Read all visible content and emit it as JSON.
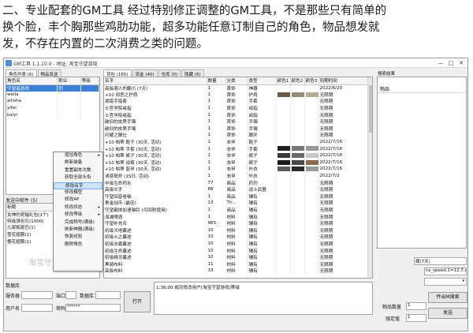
{
  "caption": {
    "line1": "二、专业配套的GM工具   经过特别修正调整的GM工具，不是那些只有简单的",
    "line2": "换个脸，丰个胸那些鸡肋功能，超多功能任意订制自己的角色，物品想发就",
    "line3": "发，不存在内置的二次消费之类的问题。"
  },
  "window": {
    "title": "GM工具 1.1.10.0 - 地址: 淘宝守望游戏",
    "min": "—",
    "max": "□",
    "close": "✕"
  },
  "left": {
    "tabs": [
      "角色列表 (6)",
      "物品发送"
    ],
    "columns": [
      "角色名",
      "职业",
      "等级"
    ],
    "rows": [
      {
        "name": "守望者游戏",
        "job": "剑",
        "level": ""
      },
      {
        "name": "weila",
        "job": "",
        "level": ""
      },
      {
        "name": "ailisha",
        "job": "",
        "level": ""
      },
      {
        "name": "yifei",
        "job": "",
        "level": ""
      },
      {
        "name": "kaiyi",
        "job": "",
        "level": ""
      }
    ],
    "mail_title": "发送中邮件 (5)",
    "mail_header": "标题",
    "mail_items": [
      "女神的祝福礼包(1个)",
      "特级强化石(1000)",
      "九尾狐尾巴(1)",
      "雪花翅膀(1)",
      "樱花翅膀(1)"
    ],
    "watermark": "淘宝守望游戏"
  },
  "context_menu": {
    "items": [
      {
        "label": "增加角色",
        "arrow": "▸"
      },
      {
        "label": "刷新装备",
        "arrow": ""
      },
      {
        "label": "重置副本次数",
        "arrow": ""
      },
      {
        "label": "获取全部头衔",
        "arrow": ""
      },
      {
        "label": "修改名字",
        "arrow": ""
      },
      {
        "label": "修改模型",
        "arrow": ""
      },
      {
        "label": "修改AP",
        "arrow": ""
      },
      {
        "label": "修改状态",
        "arrow": "▸"
      },
      {
        "label": "修改等级",
        "arrow": "▸"
      },
      {
        "label": "完成称号(满级)",
        "arrow": ""
      },
      {
        "label": "刷新神器(满级)",
        "arrow": ""
      },
      {
        "label": "恢复经验",
        "arrow": ""
      },
      {
        "label": "删除角色",
        "arrow": ""
      }
    ],
    "highlight_index": 4
  },
  "middle": {
    "tabs": [
      "背包 (165)",
      "流金 (40)",
      "仓库 (0)",
      "隐藏 (6)"
    ],
    "columns": [
      "名字",
      "数量",
      "分类",
      "类型",
      "颜色1",
      "颜色2",
      "颜色3",
      "到期时间"
    ],
    "rows": [
      {
        "name": "高级湘人的翻爪 (7天)",
        "qty": "1",
        "cat": "首饰",
        "type": "神器",
        "c": [
          "",
          "",
          ""
        ],
        "exp": "2022/6/20"
      },
      {
        "name": "+10 邪恶之护肩",
        "qty": "1",
        "cat": "首饰",
        "type": "护肩",
        "c": [
          "#6b5a4a",
          "#9a8a78",
          "#b8a994"
        ],
        "exp": "无限期"
      },
      {
        "name": "湖南手指套",
        "qty": "1",
        "cat": "首饰",
        "type": "手套",
        "c": [
          "",
          "",
          ""
        ],
        "exp": "无限期"
      },
      {
        "name": "士官学院戒指",
        "qty": "1",
        "cat": "首饰",
        "type": "戒指",
        "c": [
          "",
          "",
          ""
        ],
        "exp": "无限期"
      },
      {
        "name": "士官学院戒指",
        "qty": "1",
        "cat": "首饰",
        "type": "戒指",
        "c": [
          "",
          "",
          ""
        ],
        "exp": "无限期"
      },
      {
        "name": "破旧的皮质手镯",
        "qty": "1",
        "cat": "首饰",
        "type": "手镯",
        "c": [
          "",
          "",
          ""
        ],
        "exp": "无限期"
      },
      {
        "name": "破旧的皮质手镯",
        "qty": "1",
        "cat": "首饰",
        "type": "手镯",
        "c": [
          "",
          "",
          ""
        ],
        "exp": "无限期"
      },
      {
        "name": "闪耀之脚仕",
        "qty": "1",
        "cat": "首饰",
        "type": "脚环",
        "c": [
          "",
          "",
          ""
        ],
        "exp": "无限期"
      },
      {
        "name": "+10 帕蒂 鞋子 (30天, 活动)",
        "qty": "1",
        "cat": "衣甲",
        "type": "鞋子",
        "c": [
          "",
          "",
          ""
        ],
        "exp": "2022/7/16"
      },
      {
        "name": "+10 帕蒂 手套 (30天, 活动)",
        "qty": "1",
        "cat": "衣甲",
        "type": "手套",
        "c": [
          "#222222",
          "#777777",
          "#999999"
        ],
        "exp": "2022/7/16"
      },
      {
        "name": "+10 帕蒂 裤子 (30天, 活动)",
        "qty": "1",
        "cat": "衣甲",
        "type": "裤子",
        "c": [
          "#3a3a3a",
          "#6a6a6a",
          "#c8c8c8"
        ],
        "exp": "2022/7/16"
      },
      {
        "name": "+10 帕蒂 战裤 (30天, 活动)",
        "qty": "1",
        "cat": "衣甲",
        "type": "裤子",
        "c": [
          "#1c1c1c",
          "#4a4a4a",
          "#8a6a4a"
        ],
        "exp": "2022/7/16"
      },
      {
        "name": "+10 帕蒂 盔甲 (30天, 活动)",
        "qty": "1",
        "cat": "衣甲",
        "type": "外衣",
        "c": [
          "#5a5a5a",
          "#2a2a2a",
          "#9a9a9a"
        ],
        "exp": "2022/7/16"
      },
      {
        "name": "诱惑斑杯 (15日, 活动)",
        "qty": "1",
        "cat": "衣甲",
        "type": "外衣",
        "c": [
          "",
          "",
          ""
        ],
        "exp": "2022/7/2"
      },
      {
        "name": "中级生命药水",
        "qty": "77",
        "cat": "商品",
        "type": "药剂",
        "c": [
          "",
          "",
          ""
        ],
        "exp": "无限期"
      },
      {
        "name": "高级长手",
        "qty": "88",
        "cat": "商品",
        "type": "战斗武器",
        "c": [
          "",
          "",
          ""
        ],
        "exp": "无限期"
      },
      {
        "name": "守望回音卷轴",
        "qty": "1",
        "cat": "商品",
        "type": "辅有",
        "c": [
          "",
          "",
          ""
        ],
        "exp": "无限期"
      },
      {
        "name": "青金战币 (最佳)",
        "qty": "13",
        "cat": "Tir...",
        "type": "辅有",
        "c": [
          "",
          "",
          ""
        ],
        "exp": "无限期"
      },
      {
        "name": "守望霸体加速轴铃 (可回附使用)",
        "qty": "1",
        "cat": "商品",
        "type": "辅有",
        "c": [
          "",
          "",
          ""
        ],
        "exp": "无限期"
      },
      {
        "name": "海滩啤酒",
        "qty": "1",
        "cat": "材料",
        "type": "辅有",
        "c": [
          "",
          "",
          ""
        ],
        "exp": "无限期"
      },
      {
        "name": "守望补充币",
        "qty": "985",
        "cat": "材料",
        "type": "辅有",
        "c": [
          "",
          "",
          ""
        ],
        "exp": "无限期"
      },
      {
        "name": "初级大地囊迹",
        "qty": "10",
        "cat": "材料",
        "type": "辅有",
        "c": [
          "",
          "",
          ""
        ],
        "exp": "无限期"
      },
      {
        "name": "初级火之囊迹",
        "qty": "10",
        "cat": "材料",
        "type": "辅有",
        "c": [
          "",
          "",
          ""
        ],
        "exp": "无限期"
      },
      {
        "name": "初级水霜囊迹",
        "qty": "10",
        "cat": "材料",
        "type": "辅有",
        "c": [
          "",
          "",
          ""
        ],
        "exp": "无限期"
      },
      {
        "name": "初级生命囊迹",
        "qty": "10",
        "cat": "材料",
        "type": "辅有",
        "c": [
          "",
          "",
          ""
        ],
        "exp": "无限期"
      },
      {
        "name": "初级精灵囊迹",
        "qty": "10",
        "cat": "材料",
        "type": "辅有",
        "c": [
          "",
          "",
          ""
        ],
        "exp": "无限期"
      },
      {
        "name": "黑骑布料",
        "qty": "11",
        "cat": "材料",
        "type": "辅有",
        "c": [
          "",
          "",
          ""
        ],
        "exp": "无限期"
      },
      {
        "name": "高级布料",
        "qty": "33",
        "cat": "材料",
        "type": "辅有",
        "c": [
          "",
          "",
          ""
        ],
        "exp": "无限期"
      }
    ]
  },
  "right": {
    "title": "搜索结果",
    "header": "物品",
    "field_days": "属(7天)",
    "field_code": "ca_speed,1=12,7,m",
    "qty_label": "物品数量",
    "qty_value": "1",
    "pages_label": "强定值",
    "pages_value": "1",
    "search_btn": "件出M搜索",
    "send_btn": "发送"
  },
  "bottom": {
    "db_label": "数据库",
    "server_label": "服务器",
    "port_label": "端口",
    "db2_label": "数据库",
    "user_label": "用户名",
    "pwd_label": "密码",
    "pwd_value": "******",
    "open_btn": "打开",
    "log": "1:36:00   成功修改用户[淘宝守望游戏]等级"
  }
}
